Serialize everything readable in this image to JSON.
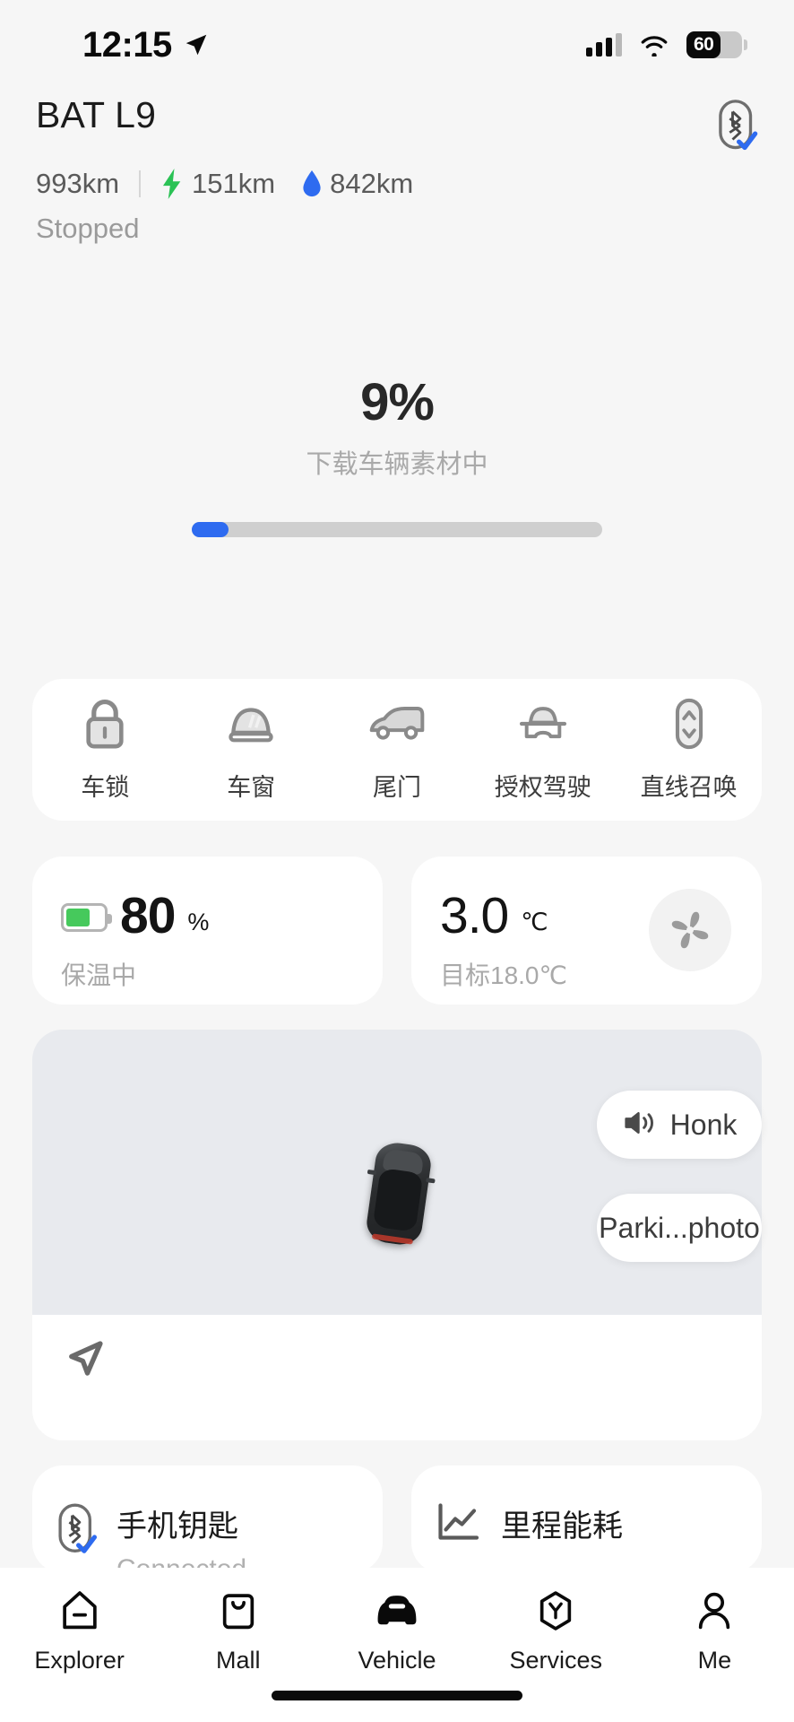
{
  "statusbar": {
    "time": "12:15",
    "location_icon": "location-arrow-icon",
    "signal_icon": "cellular-signal-icon",
    "wifi_icon": "wifi-icon",
    "battery_level": "60"
  },
  "header": {
    "car_name": "BAT L9",
    "total_range": "993km",
    "electric_range": "151km",
    "fuel_range": "842km",
    "status": "Stopped",
    "key_badge_icon": "bluetooth-key-verified-icon"
  },
  "progress": {
    "percent": "9%",
    "label": "下载车辆素材中",
    "fill_ratio": 0.09,
    "fill_color": "#2E6BF0",
    "track_color": "#CFCFCF"
  },
  "quick_actions": [
    {
      "label": "车锁",
      "icon": "lock-icon"
    },
    {
      "label": "车窗",
      "icon": "window-icon"
    },
    {
      "label": "尾门",
      "icon": "tailgate-icon"
    },
    {
      "label": "授权驾驶",
      "icon": "authorized-driving-icon"
    },
    {
      "label": "直线召唤",
      "icon": "straight-summon-icon"
    }
  ],
  "battery_card": {
    "value": "80",
    "unit": "%",
    "status": "保温中",
    "icon": "battery-icon",
    "fill_color": "#46C95C"
  },
  "climate_card": {
    "value": "3.0",
    "unit": "℃",
    "status": "目标18.0℃",
    "icon": "fan-icon"
  },
  "map_card": {
    "car_icon": "car-top-view-icon",
    "navigate_icon": "navigate-arrow-icon",
    "honk_button": "Honk",
    "honk_icon": "speaker-icon",
    "photo_button": "Parki...photo",
    "background_color": "#E8EAEE"
  },
  "feature_cards": [
    {
      "title": "手机钥匙",
      "subtitle": "Connected",
      "icon": "bluetooth-key-verified-icon"
    },
    {
      "title": "里程能耗",
      "subtitle": "",
      "icon": "chart-line-icon"
    }
  ],
  "tabbar": [
    {
      "label": "Explorer",
      "icon": "explorer-icon",
      "active": false
    },
    {
      "label": "Mall",
      "icon": "mall-bag-icon",
      "active": false
    },
    {
      "label": "Vehicle",
      "icon": "vehicle-car-icon",
      "active": true
    },
    {
      "label": "Services",
      "icon": "services-hex-icon",
      "active": false
    },
    {
      "label": "Me",
      "icon": "person-icon",
      "active": false
    }
  ]
}
